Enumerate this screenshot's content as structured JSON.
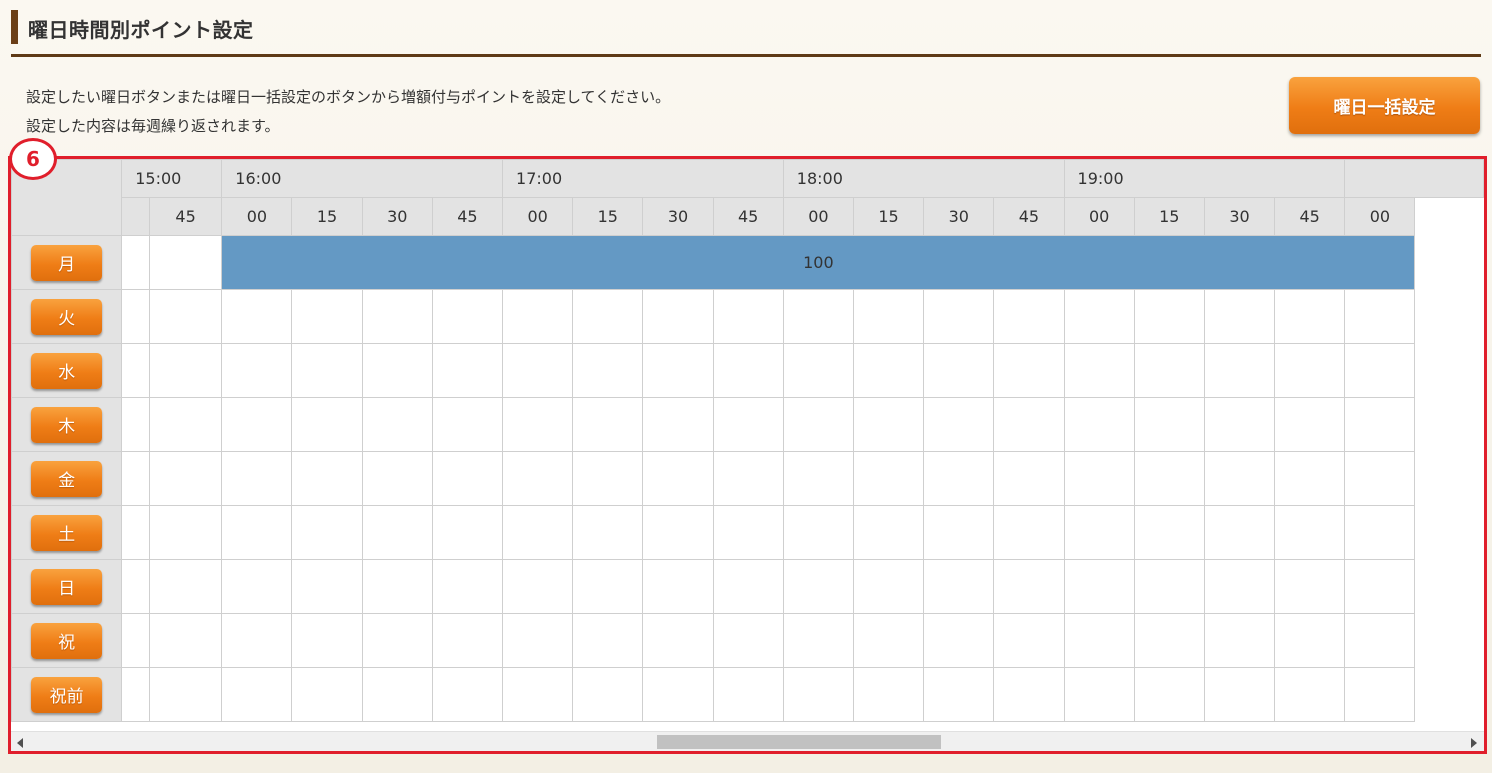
{
  "header": {
    "title": "曜日時間別ポイント設定"
  },
  "description": {
    "line1": "設定したい曜日ボタンまたは曜日一括設定のボタンから増額付与ポイントを設定してください。",
    "line2": "設定した内容は毎週繰り返されます。"
  },
  "bulk_button_label": "曜日一括設定",
  "callout_number": "6",
  "grid": {
    "hours": [
      "15:00",
      "16:00",
      "17:00",
      "18:00",
      "19:00",
      ""
    ],
    "minutes": [
      "",
      "45",
      "00",
      "15",
      "30",
      "45",
      "00",
      "15",
      "30",
      "45",
      "00",
      "15",
      "30",
      "45",
      "00",
      "15",
      "30",
      "45",
      "00"
    ],
    "days": [
      "月",
      "火",
      "水",
      "木",
      "金",
      "土",
      "日",
      "祝",
      "祝前"
    ],
    "monday_point_value": "100"
  },
  "colors": {
    "accent_orange": "#ef7d16",
    "point_band_blue": "#6499c4",
    "highlight_red": "#e01e2b",
    "title_bar_brown": "#6b3f17"
  }
}
